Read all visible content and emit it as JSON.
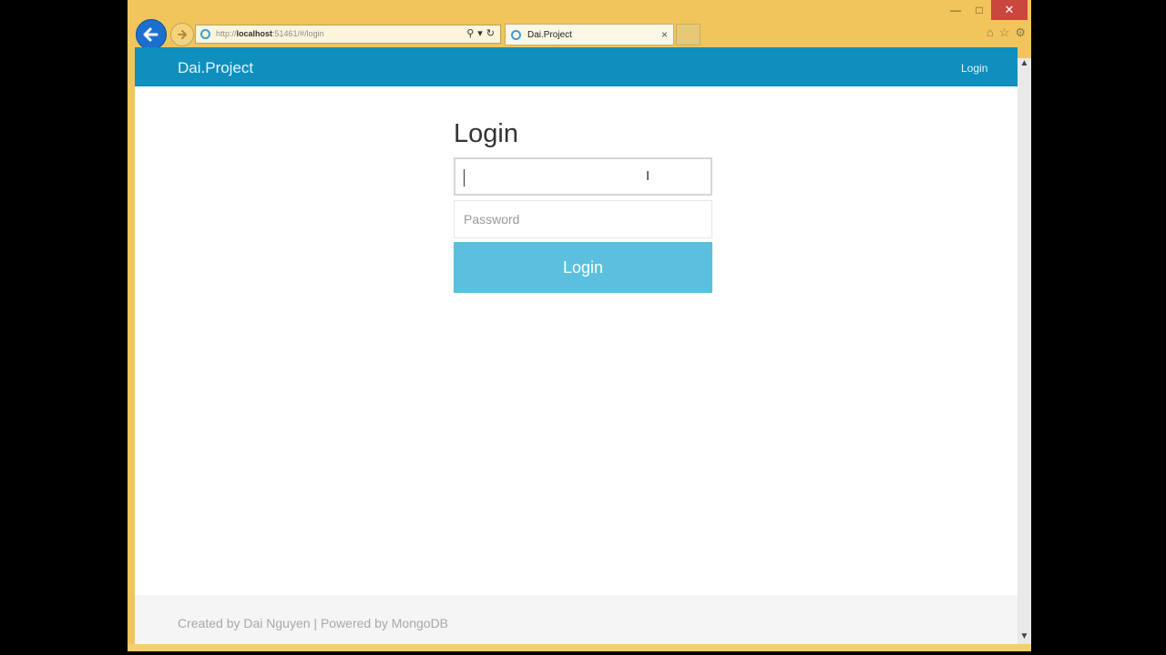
{
  "browser": {
    "url_prefix": "http://",
    "url_host": "localhost",
    "url_rest": ":51461/#/login",
    "tab_title": "Dai.Project",
    "tab_close": "×",
    "win_min": "—",
    "win_max": "□",
    "win_close": "✕",
    "addr_search": "⚲",
    "addr_dropdown": "▾",
    "addr_refresh": "↻",
    "home": "⌂",
    "favorites": "☆",
    "settings": "⚙"
  },
  "navbar": {
    "brand": "Dai.Project",
    "login_link": "Login"
  },
  "login": {
    "title": "Login",
    "username_value": "",
    "password_placeholder": "Password",
    "button_label": "Login"
  },
  "footer": {
    "text": "Created by Dai Nguyen | Powered by MongoDB"
  },
  "colors": {
    "navbar": "#0f8fbd",
    "button": "#5bc0de",
    "browser_chrome": "#f1c55b"
  }
}
